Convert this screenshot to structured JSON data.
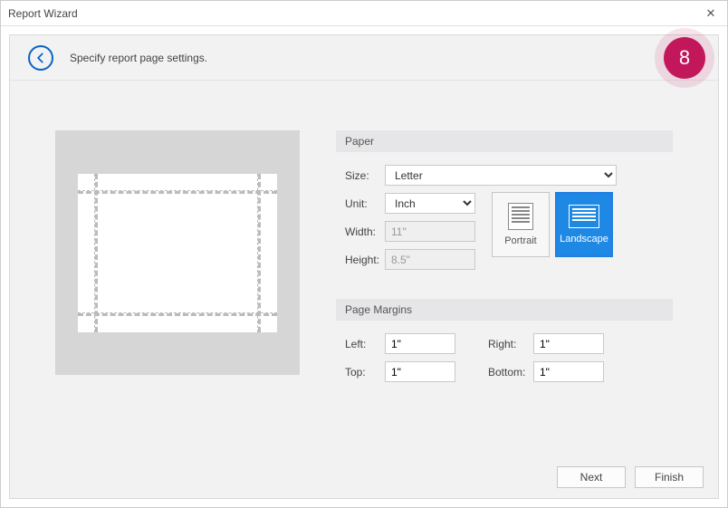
{
  "window": {
    "title": "Report Wizard"
  },
  "header": {
    "text": "Specify report page settings.",
    "step": "8"
  },
  "paper": {
    "section": "Paper",
    "size_label": "Size:",
    "size_value": "Letter",
    "unit_label": "Unit:",
    "unit_value": "Inch",
    "width_label": "Width:",
    "width_value": "11\"",
    "height_label": "Height:",
    "height_value": "8.5\"",
    "orientation": {
      "portrait_label": "Portrait",
      "landscape_label": "Landscape",
      "selected": "landscape"
    }
  },
  "margins": {
    "section": "Page Margins",
    "left_label": "Left:",
    "left_value": "1\"",
    "right_label": "Right:",
    "right_value": "1\"",
    "top_label": "Top:",
    "top_value": "1\"",
    "bottom_label": "Bottom:",
    "bottom_value": "1\""
  },
  "footer": {
    "next": "Next",
    "finish": "Finish"
  }
}
